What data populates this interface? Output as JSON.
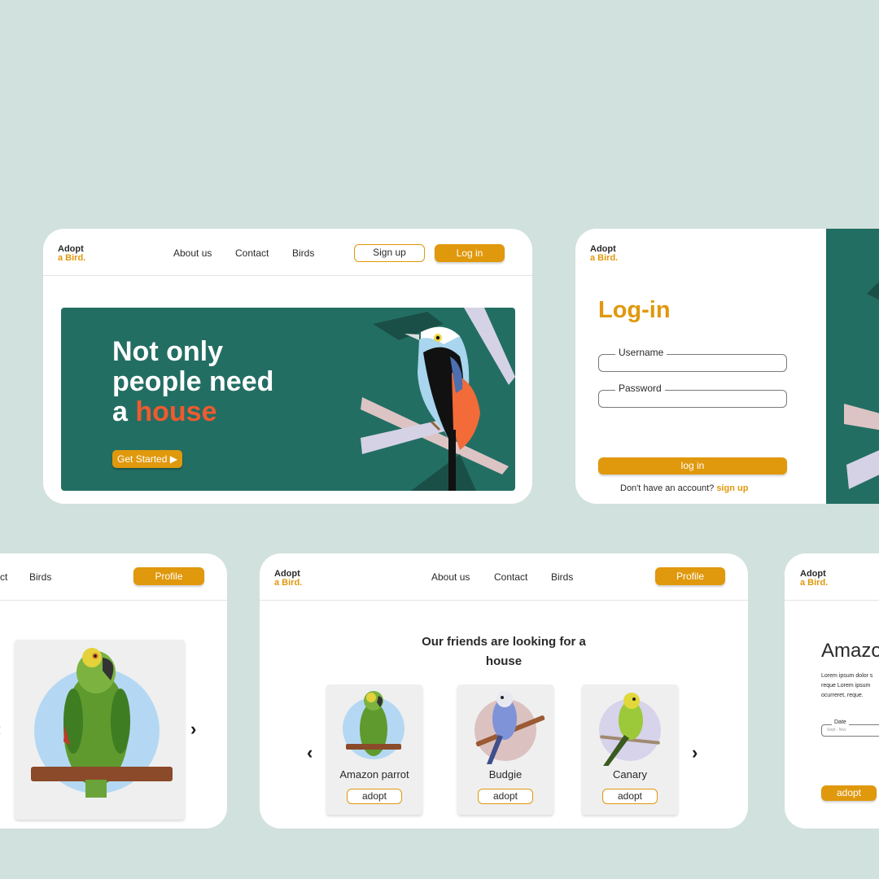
{
  "brand": {
    "line1": "Adopt",
    "line2": "a Bird."
  },
  "landing": {
    "nav": [
      "About us",
      "Contact",
      "Birds"
    ],
    "signup": "Sign up",
    "login": "Log in",
    "hero": {
      "line1": "Not only",
      "line2": "people need",
      "line3_prefix": "a",
      "line3_accent": "house",
      "cta": "Get Started",
      "cta_icon": "play-icon"
    }
  },
  "login_page": {
    "title": "Log-in",
    "username_label": "Username",
    "password_label": "Password",
    "submit": "log in",
    "no_account": "Don't have an account?",
    "signup_link": "sign up"
  },
  "detail_page": {
    "nav": [
      "ct",
      "Birds"
    ],
    "profile": "Profile"
  },
  "listing_page": {
    "nav": [
      "About us",
      "Contact",
      "Birds"
    ],
    "profile": "Profile",
    "heading_line1": "Our friends are looking for a",
    "heading_line2": "house",
    "birds": [
      {
        "name": "Amazon parrot",
        "action": "adopt"
      },
      {
        "name": "Budgie",
        "action": "adopt"
      },
      {
        "name": "Canary",
        "action": "adopt"
      }
    ]
  },
  "adopt_page": {
    "title": "Amazo",
    "lorem_lines": [
      "Lorem ipsum dolor s",
      "reque Lorem ipsum",
      "ocurreret, reque."
    ],
    "date_label": "Date",
    "date_value": "Sept - Nov",
    "submit": "adopt"
  },
  "colors": {
    "accent": "#e0980c",
    "teal": "#236e63",
    "coral": "#f05a2e",
    "background": "#d1e1dd"
  }
}
